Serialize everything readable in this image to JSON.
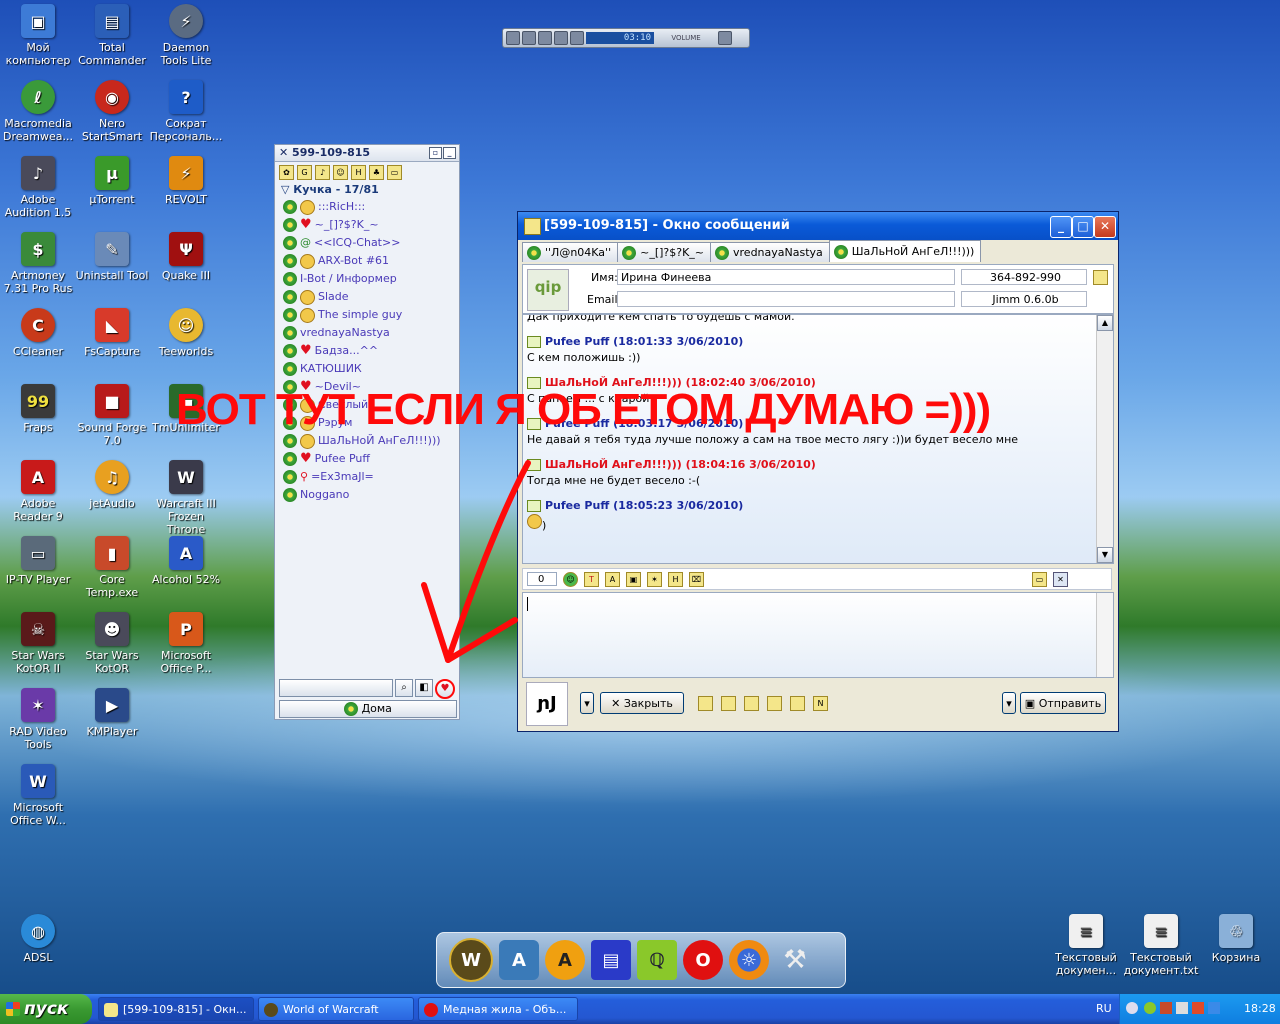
{
  "desktop_icons": [
    {
      "label": "Мой компьютер",
      "icon": "my-computer-icon",
      "color": "#3d7bd6"
    },
    {
      "label": "Total Commander",
      "icon": "total-commander-icon",
      "color": "#2b5fb8"
    },
    {
      "label": "Daemon Tools Lite",
      "icon": "daemon-tools-icon",
      "color": "#5a6b82"
    },
    {
      "label": "Macromedia Dreamwea...",
      "icon": "dreamweaver-icon",
      "color": "#3a9a3a"
    },
    {
      "label": "Nero StartSmart",
      "icon": "nero-icon",
      "color": "#c8281c"
    },
    {
      "label": "Сократ Персональ...",
      "icon": "socrat-icon",
      "color": "#1e5cc8"
    },
    {
      "label": "Adobe Audition 1.5",
      "icon": "audition-icon",
      "color": "#4a4a5a"
    },
    {
      "label": "µTorrent",
      "icon": "utorrent-icon",
      "color": "#3a9a2a"
    },
    {
      "label": "REVOLT",
      "icon": "revolt-icon",
      "color": "#e08a10"
    },
    {
      "label": "Artmoney 7.31 Pro Rus",
      "icon": "artmoney-icon",
      "color": "#3a8a3a"
    },
    {
      "label": "Uninstall Tool",
      "icon": "uninstall-tool-icon",
      "color": "#6a8ab8"
    },
    {
      "label": "Quake III",
      "icon": "quake-icon",
      "color": "#a01010"
    },
    {
      "label": "CCleaner",
      "icon": "ccleaner-icon",
      "color": "#c83a1a"
    },
    {
      "label": "FsCapture",
      "icon": "fscapture-icon",
      "color": "#d83a2a"
    },
    {
      "label": "Teeworlds",
      "icon": "teeworlds-icon",
      "color": "#e8b830"
    },
    {
      "label": "Fraps",
      "icon": "fraps-icon",
      "color": "#3a3a3a"
    },
    {
      "label": "Sound Forge 7.0",
      "icon": "sound-forge-icon",
      "color": "#b81a1a"
    },
    {
      "label": "TmUnlimiter",
      "icon": "tmunlimiter-icon",
      "color": "#2a6a2a"
    },
    {
      "label": "Adobe Reader 9",
      "icon": "adobe-reader-icon",
      "color": "#c81a1a"
    },
    {
      "label": "jetAudio",
      "icon": "jetaudio-icon",
      "color": "#e8a020"
    },
    {
      "label": "Warcraft III Frozen Throne",
      "icon": "warcraft-icon",
      "color": "#3a3a4a"
    },
    {
      "label": "IP-TV Player",
      "icon": "iptv-icon",
      "color": "#5a6a7a"
    },
    {
      "label": "Core Temp.exe",
      "icon": "core-temp-icon",
      "color": "#c84a2a"
    },
    {
      "label": "Alcohol 52%",
      "icon": "alcohol-icon",
      "color": "#2a5ac8"
    },
    {
      "label": "Star Wars KotOR II",
      "icon": "kotor2-icon",
      "color": "#5a1a1a"
    },
    {
      "label": "Star Wars KotOR",
      "icon": "kotor-icon",
      "color": "#4a4a5a"
    },
    {
      "label": "Microsoft Office P...",
      "icon": "powerpoint-icon",
      "color": "#d8581a"
    },
    {
      "label": "RAD Video Tools",
      "icon": "rad-video-icon",
      "color": "#6a3aa8"
    },
    {
      "label": "KMPlayer",
      "icon": "kmplayer-icon",
      "color": "#2a4a8a"
    },
    {
      "label": "Microsoft Office W...",
      "icon": "word-icon",
      "color": "#2a5ab8"
    },
    {
      "label": "ADSL",
      "icon": "adsl-icon",
      "color": "#2a8ad8"
    },
    {
      "label": "Текстовый докумен...",
      "icon": "text-document-icon",
      "color": "#f0f0f0"
    },
    {
      "label": "Текстовый документ.txt",
      "icon": "text-document-icon",
      "color": "#f0f0f0"
    },
    {
      "label": "Корзина",
      "icon": "recycle-bin-icon",
      "color": "#8ab0d8"
    }
  ],
  "player": {
    "time": "03:10",
    "volume_label": "VOLUME"
  },
  "contact_list": {
    "title": "599-109-815",
    "group": "Кучка - 17/81",
    "contacts": [
      {
        "name": ":::RicH:::"
      },
      {
        "name": "~_[]?$?K_~"
      },
      {
        "name": "<<ICQ-Chat>>"
      },
      {
        "name": "ARX-Bot #61"
      },
      {
        "name": "I-Bot / Информер"
      },
      {
        "name": "Slade"
      },
      {
        "name": "The simple guy"
      },
      {
        "name": "vrednayaNastya"
      },
      {
        "name": "Бадза...^^"
      },
      {
        "name": "КАТЮШИК"
      },
      {
        "name": "~Devil~"
      },
      {
        "name": "Светлый"
      },
      {
        "name": "Рэрум"
      },
      {
        "name": "ШаЛьНоЙ АнГеЛ!!!)))"
      },
      {
        "name": "Pufee Puff"
      },
      {
        "name": "=Ex3maJl="
      },
      {
        "name": "Noggano"
      }
    ],
    "status_label": "Дома"
  },
  "chat": {
    "title": "[599-109-815] - Окно сообщений",
    "tabs": [
      "''Л@n04Ka''",
      "~_[]?$?K_~",
      "vrednayaNastya",
      "ШаЛьНоЙ АнГеЛ!!!)))"
    ],
    "info": {
      "name_label": "Имя:",
      "name_value": "Ирина  Финеева",
      "email_label": "Email:",
      "email_value": "",
      "uin": "364-892-990",
      "client": "Jimm 0.6.0b",
      "logo": "qip"
    },
    "log_top_cut": "Дак приходите кем спать то будешь с мамой.",
    "messages": [
      {
        "who": "me",
        "header": "Pufee Puff (18:01:33 3/06/2010)",
        "text": "С кем положишь :))"
      },
      {
        "who": "them",
        "header": "ШаЛьНоЙ АнГеЛ!!!))) (18:02:40 3/06/2010)",
        "text": "С папаем ... с кларой"
      },
      {
        "who": "me",
        "header": "Pufee Puff (18:03:17 3/06/2010)",
        "text": "Не давай я тебя туда лучше положу а сам на твое место лягу :))и будет весело мне"
      },
      {
        "who": "them",
        "header": "ШаЛьНоЙ АнГеЛ!!!))) (18:04:16 3/06/2010)",
        "text": "Тогда мне не будет весело :-("
      },
      {
        "who": "me",
        "header": "Pufee Puff (18:05:23 3/06/2010)",
        "text": ")"
      }
    ],
    "char_count": "0",
    "close_label": "Закрыть",
    "send_label": "Отправить"
  },
  "annotation": "ВОТ ТУТ ЕСЛИ Я ОБ ЕТОМ ДУМАЮ =)))",
  "taskbar": {
    "start_label": "пуск",
    "tasks": [
      "[599-109-815] - Окн...",
      "World of Warcraft",
      "Медная жила - Объ..."
    ],
    "lang": "RU",
    "clock": "18:28"
  },
  "colors": {
    "annotation": "#ff0a0a",
    "xp_blue": "#0a5ad8",
    "start_green": "#3a9a32"
  }
}
